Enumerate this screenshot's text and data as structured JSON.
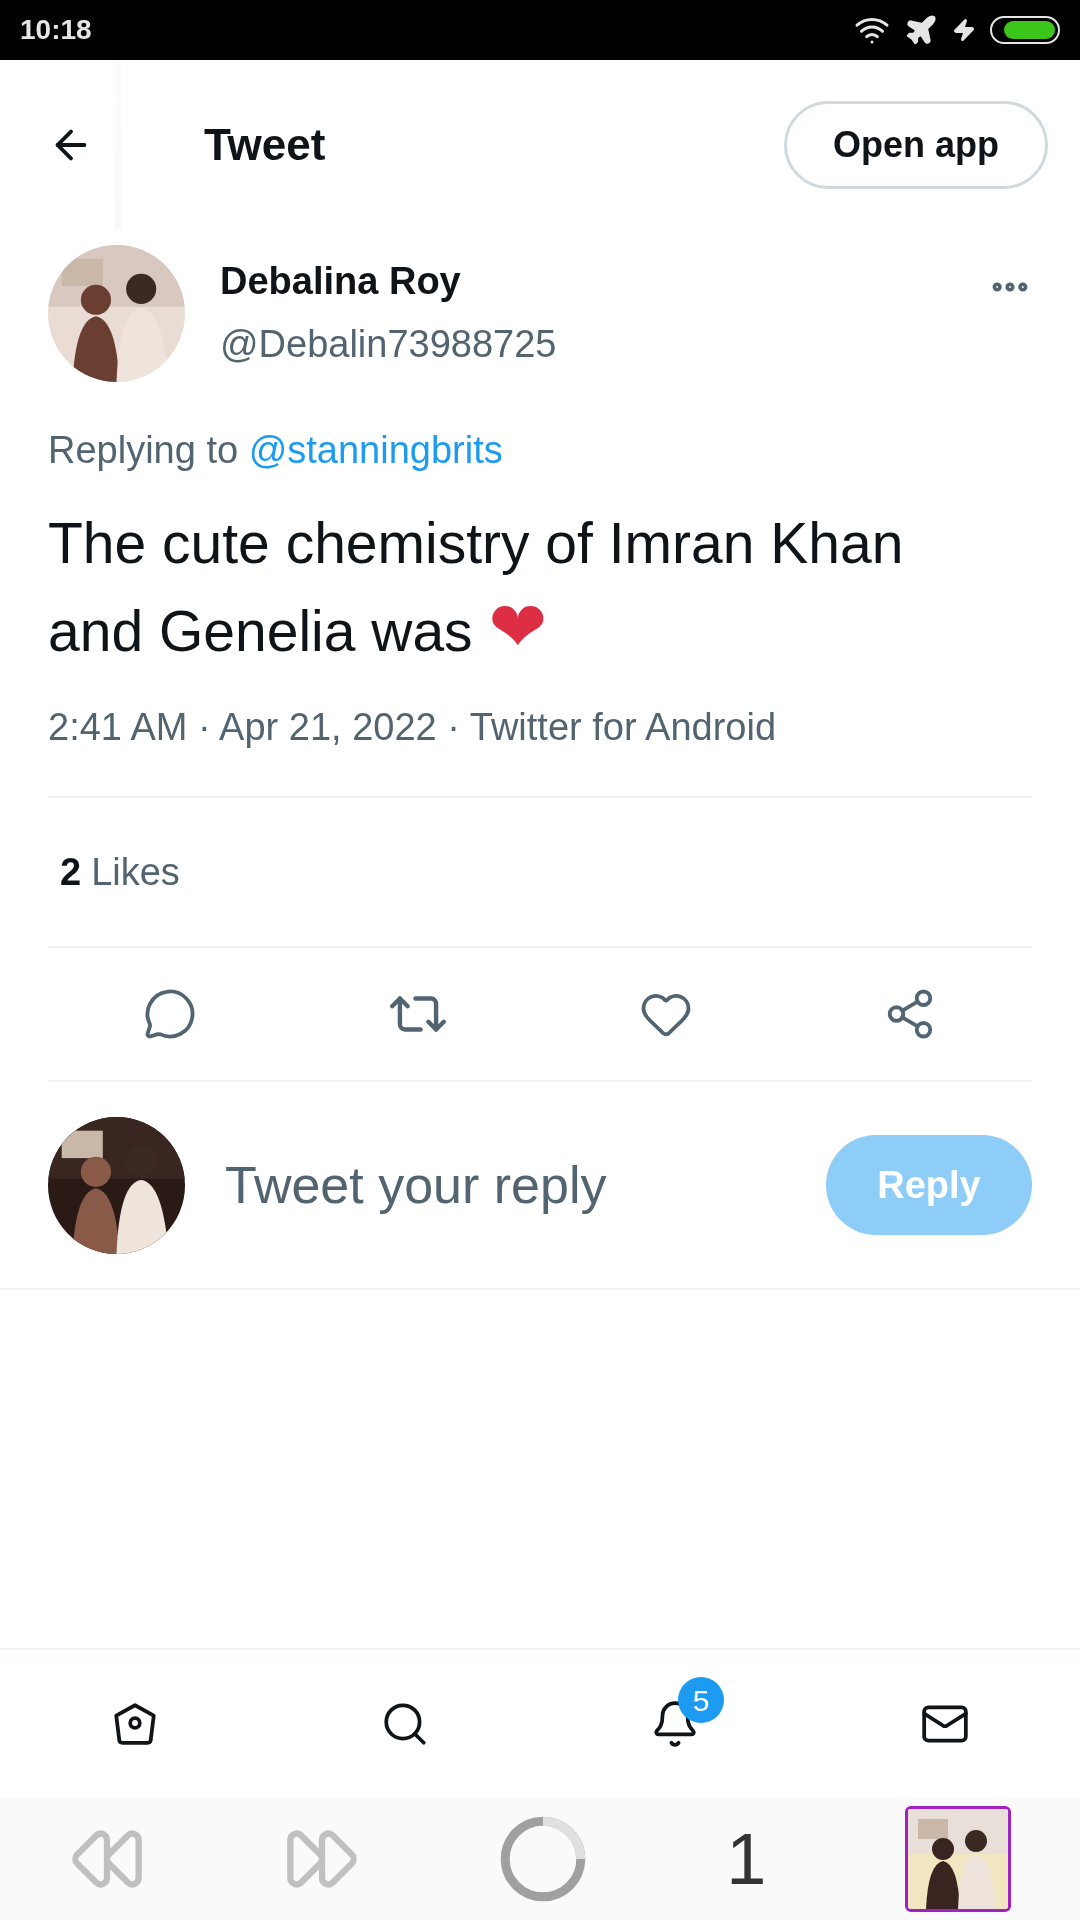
{
  "status_bar": {
    "time": "10:18"
  },
  "header": {
    "title": "Tweet",
    "open_app": "Open app"
  },
  "tweet": {
    "author": {
      "name": "Debalina Roy",
      "handle": "@Debalin73988725"
    },
    "replying_prefix": "Replying to",
    "replying_to": "@stanningbrits",
    "text": "The cute chemistry of Imran Khan and Genelia was",
    "emoji": "❤",
    "meta": "2:41 AM · Apr 21, 2022 · Twitter for Android",
    "likes_count": "2",
    "likes_label": "Likes"
  },
  "reply_box": {
    "placeholder": "Tweet your reply",
    "button": "Reply",
    "button_disabled": true
  },
  "bottom_nav": {
    "items": [
      {
        "kind": "home"
      },
      {
        "kind": "search"
      },
      {
        "kind": "notifications",
        "badge": "5"
      },
      {
        "kind": "messages"
      }
    ]
  },
  "browser_bar": {
    "tab_count": "1"
  }
}
